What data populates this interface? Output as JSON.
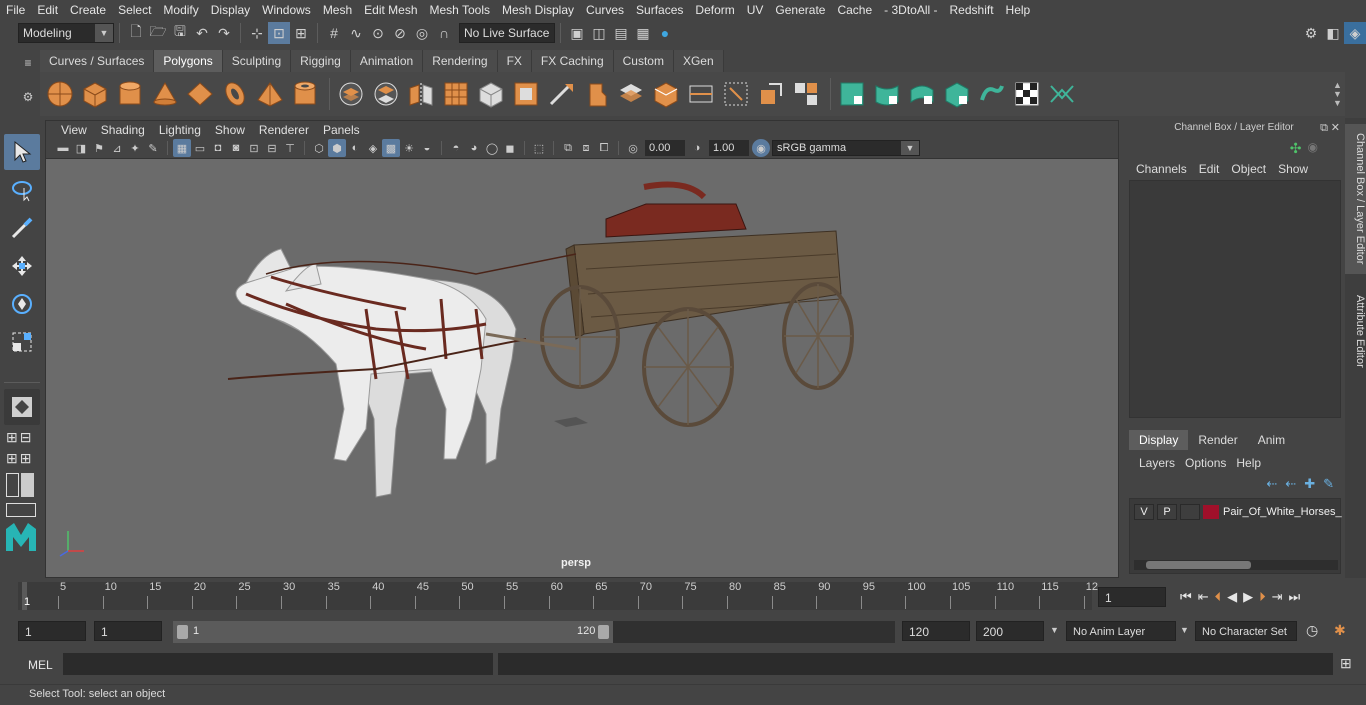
{
  "menubar": [
    "File",
    "Edit",
    "Create",
    "Select",
    "Modify",
    "Display",
    "Windows",
    "Mesh",
    "Edit Mesh",
    "Mesh Tools",
    "Mesh Display",
    "Curves",
    "Surfaces",
    "Deform",
    "UV",
    "Generate",
    "Cache",
    "- 3DtoAll -",
    "Redshift",
    "Help"
  ],
  "statusline": {
    "workspace": "Modeling",
    "live_surface": "No Live Surface"
  },
  "shelf": {
    "tabs": [
      "Curves / Surfaces",
      "Polygons",
      "Sculpting",
      "Rigging",
      "Animation",
      "Rendering",
      "FX",
      "FX Caching",
      "Custom",
      "XGen"
    ],
    "active_tab": "Polygons"
  },
  "viewport": {
    "menu": [
      "View",
      "Shading",
      "Lighting",
      "Show",
      "Renderer",
      "Panels"
    ],
    "exposure": "0.00",
    "gamma": "1.00",
    "color_space": "sRGB gamma",
    "camera_label": "persp"
  },
  "right_panel": {
    "title": "Channel Box / Layer Editor",
    "menu": [
      "Channels",
      "Edit",
      "Object",
      "Show"
    ],
    "tabs": [
      "Display",
      "Render",
      "Anim"
    ],
    "active_tab": "Display",
    "layer_menu": [
      "Layers",
      "Options",
      "Help"
    ],
    "layer": {
      "visible": "V",
      "playback": "P",
      "name": "Pair_Of_White_Horses_",
      "color": "#a0102a"
    },
    "side_tabs": [
      "Channel Box / Layer Editor",
      "Attribute Editor"
    ]
  },
  "timeline": {
    "ticks": [
      "5",
      "10",
      "15",
      "20",
      "25",
      "30",
      "35",
      "40",
      "45",
      "50",
      "55",
      "60",
      "65",
      "70",
      "75",
      "80",
      "85",
      "90",
      "95",
      "100",
      "105",
      "110",
      "115",
      "12"
    ],
    "start_label": "1",
    "current_frame": "1"
  },
  "range": {
    "start": "1",
    "playback_start": "1",
    "slider_start": "1",
    "slider_end": "120",
    "playback_end": "120",
    "end": "200",
    "anim_layer": "No Anim Layer",
    "character_set": "No Character Set"
  },
  "command_line": {
    "label": "MEL"
  },
  "help_line": "Select Tool: select an object",
  "colors": {
    "shelf_orange": "#e0904a",
    "shelf_teal": "#3fb59a",
    "select_blue": "#5b7b9e",
    "maya_teal": "#27b5b5"
  }
}
